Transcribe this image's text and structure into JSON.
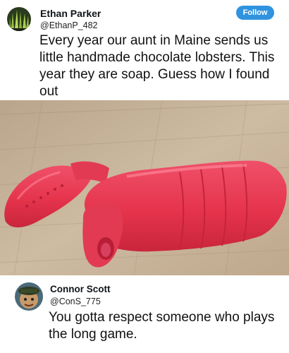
{
  "tweet": {
    "author_name": "Ethan Parker",
    "author_handle": "@EthanP_482",
    "follow_label": "Follow",
    "text": "Every year our aunt in Maine sends us little handmade chocolate lobsters. This year they are soap. Guess how I found out",
    "image": "red soap lobster on wooden cutting board"
  },
  "reply": {
    "author_name": "Connor Scott",
    "author_handle": "@ConS_775",
    "text": "You gotta respect someone who plays the long game."
  },
  "colors": {
    "follow_button": "#2f93e0",
    "lobster": "#e8384f",
    "wood": "#c8b49a"
  }
}
